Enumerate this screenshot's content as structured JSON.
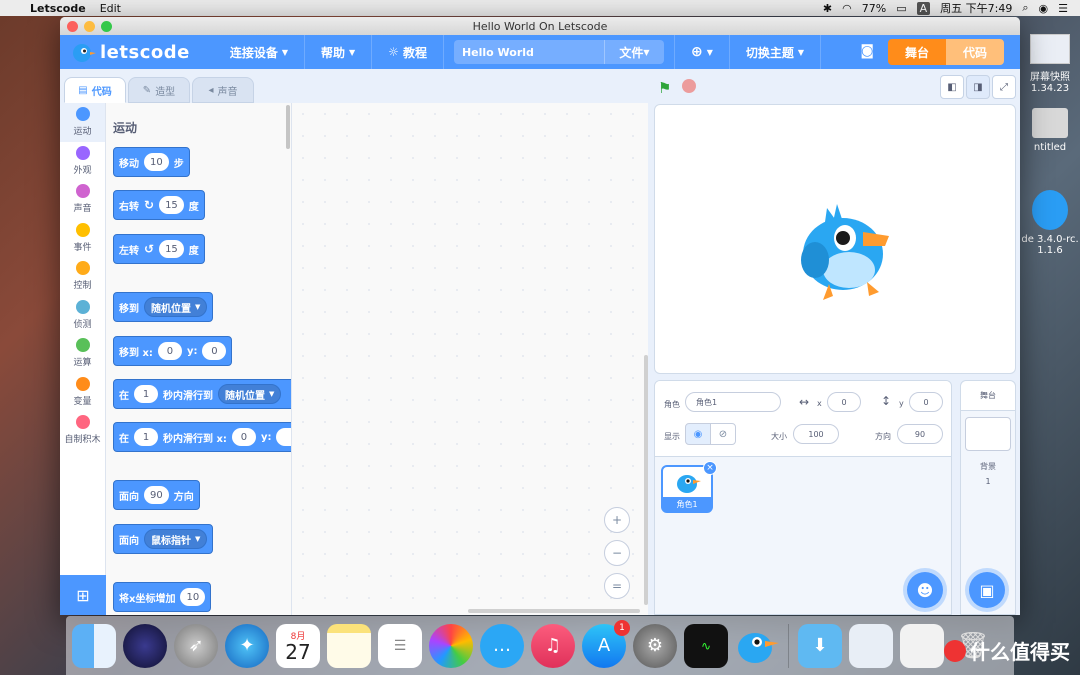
{
  "menubar": {
    "app_name": "Letscode",
    "edit": "Edit",
    "battery": "77%",
    "input": "A",
    "datetime": "周五 下午7:49"
  },
  "desktop": {
    "item1": "屏幕快照",
    "item1_sub": "1.34.23",
    "item2": "ntitled",
    "item3": "de 3.4.0-rc.",
    "item3_sub": "1.1.6"
  },
  "window": {
    "title": "Hello World On Letscode"
  },
  "header": {
    "logo": "letscode",
    "connect": "连接设备",
    "help": "帮助",
    "tutorial": "教程",
    "project_title": "Hello World",
    "file": "文件",
    "theme": "切换主题",
    "stage_tab": "舞台",
    "code_tab": "代码"
  },
  "tabs": {
    "code": "代码",
    "costume": "造型",
    "sound": "声音"
  },
  "categories": [
    {
      "label": "运动",
      "color": "#4c97ff"
    },
    {
      "label": "外观",
      "color": "#9966ff"
    },
    {
      "label": "声音",
      "color": "#cf63cf"
    },
    {
      "label": "事件",
      "color": "#ffbf00"
    },
    {
      "label": "控制",
      "color": "#ffab19"
    },
    {
      "label": "侦测",
      "color": "#5cb1d6"
    },
    {
      "label": "运算",
      "color": "#59c059"
    },
    {
      "label": "变量",
      "color": "#ff8c1a"
    },
    {
      "label": "自制积木",
      "color": "#ff6680"
    }
  ],
  "palette": {
    "title": "运动",
    "move_label": "移动",
    "move_steps": "10",
    "move_unit": "步",
    "turn_right_label": "右转",
    "turn_right_val": "15",
    "turn_right_unit": "度",
    "turn_left_label": "左转",
    "turn_left_val": "15",
    "turn_left_unit": "度",
    "goto_label": "移到",
    "goto_target": "随机位置",
    "gotoxy_label": "移到 x:",
    "gotoxy_x": "0",
    "gotoxy_y_label": "y:",
    "gotoxy_y": "0",
    "glide1_in": "在",
    "glide1_secs": "1",
    "glide1_text": "秒内滑行到",
    "glide1_target": "随机位置",
    "glide2_in": "在",
    "glide2_secs": "1",
    "glide2_text": "秒内滑行到 x:",
    "glide2_x": "0",
    "glide2_y_label": "y:",
    "point_label": "面向",
    "point_val": "90",
    "point_unit": "方向",
    "pointto_label": "面向",
    "pointto_target": "鼠标指针",
    "changex_label": "将x坐标增加",
    "changex_val": "10"
  },
  "sprite_info": {
    "sprite_label": "角色",
    "sprite_name": "角色1",
    "x_label": "x",
    "x_value": "0",
    "y_label": "y",
    "y_value": "0",
    "show_label": "显示",
    "size_label": "大小",
    "size_value": "100",
    "direction_label": "方向",
    "direction_value": "90",
    "thumb_name": "角色1"
  },
  "stage_panel": {
    "title": "舞台",
    "backdrop_label": "背景",
    "backdrop_count": "1"
  },
  "dock": {
    "calendar_month": "8月",
    "calendar_day": "27",
    "appstore_badge": "1"
  },
  "watermark": {
    "text": "什么值得买"
  }
}
